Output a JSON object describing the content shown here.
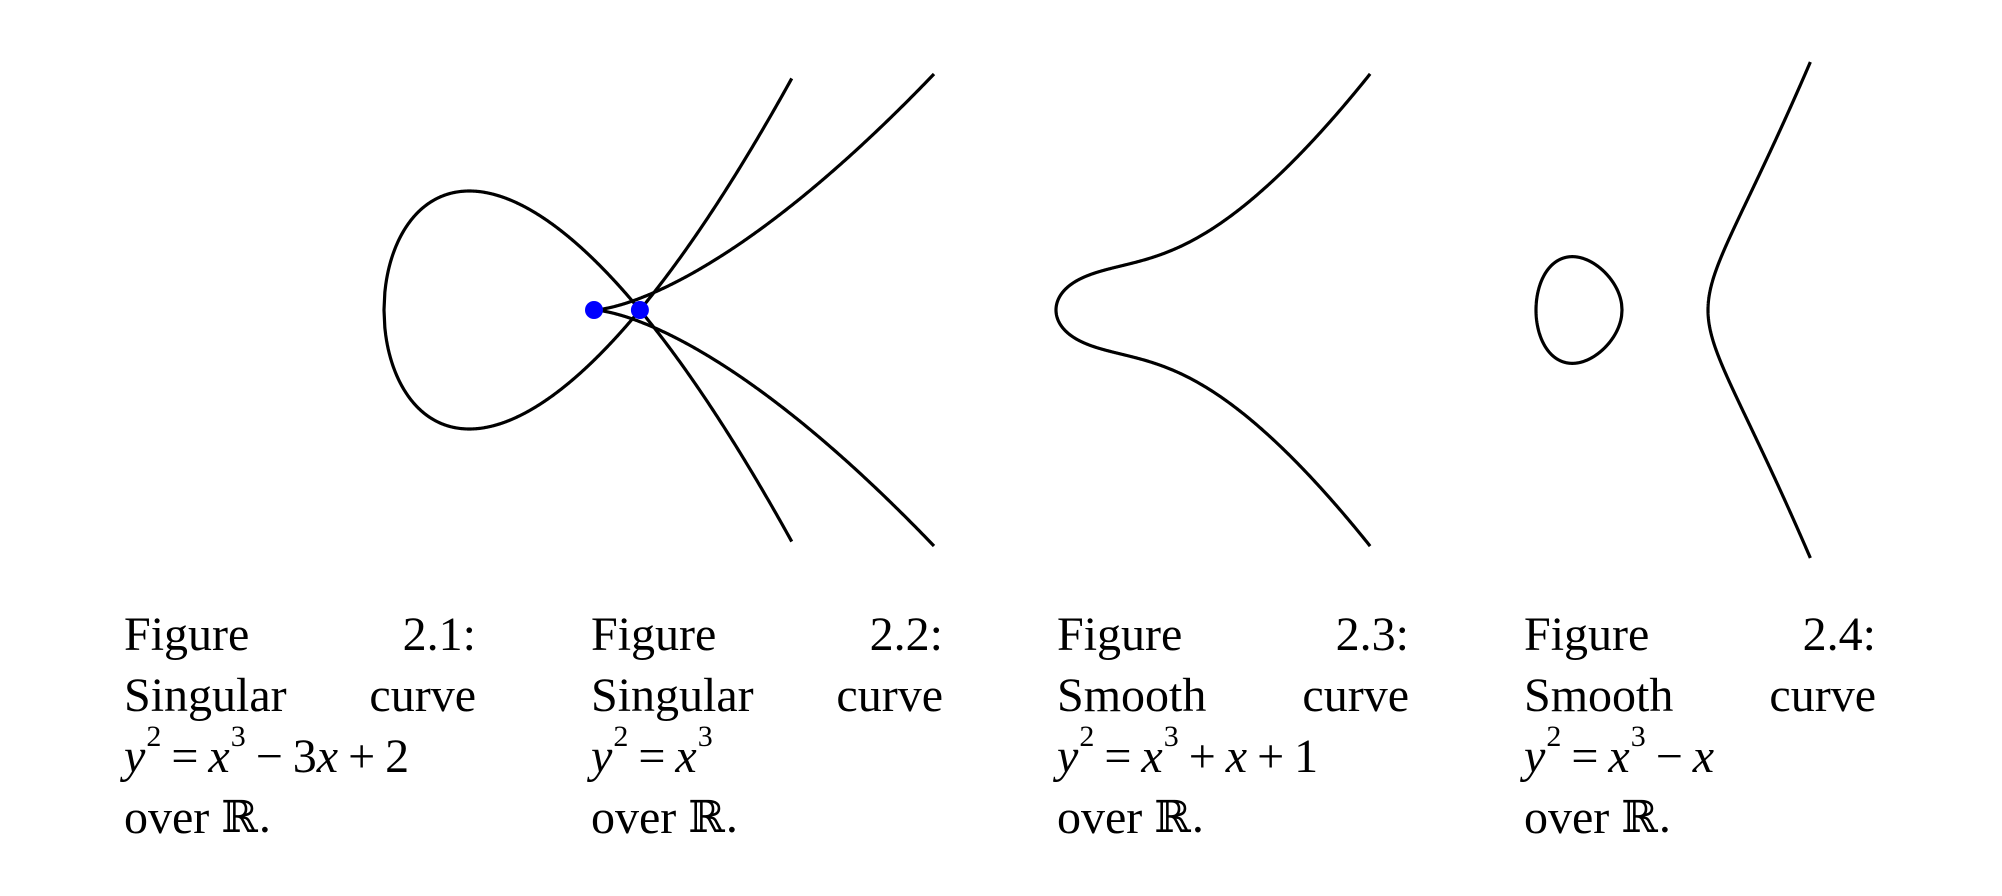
{
  "figures": [
    {
      "label": "Figure",
      "number": "2.1:",
      "description_1": "Singular",
      "description_2": "curve",
      "equation": [
        {
          "t": "y",
          "it": true
        },
        {
          "sup": "2"
        },
        {
          "op": "="
        },
        {
          "t": "x",
          "it": true
        },
        {
          "sup": "3"
        },
        {
          "op": "−"
        },
        {
          "t": "3"
        },
        {
          "t": "x",
          "it": true
        },
        {
          "op": "+"
        },
        {
          "t": "2"
        }
      ],
      "over": "over",
      "field": "ℝ.",
      "curve": {
        "a": -3,
        "b": 2,
        "singular_point": [
          1,
          0
        ]
      }
    },
    {
      "label": "Figure",
      "number": "2.2:",
      "description_1": "Singular",
      "description_2": "curve",
      "equation": [
        {
          "t": "y",
          "it": true
        },
        {
          "sup": "2"
        },
        {
          "op": "="
        },
        {
          "t": "x",
          "it": true
        },
        {
          "sup": "3"
        }
      ],
      "over": "over",
      "field": "ℝ.",
      "curve": {
        "a": 0,
        "b": 0,
        "singular_point": [
          0,
          0
        ]
      }
    },
    {
      "label": "Figure",
      "number": "2.3:",
      "description_1": "Smooth",
      "description_2": "curve",
      "equation": [
        {
          "t": "y",
          "it": true
        },
        {
          "sup": "2"
        },
        {
          "op": "="
        },
        {
          "t": "x",
          "it": true
        },
        {
          "sup": "3"
        },
        {
          "op": "+"
        },
        {
          "t": "x",
          "it": true
        },
        {
          "op": "+"
        },
        {
          "t": "1"
        }
      ],
      "over": "over",
      "field": "ℝ.",
      "curve": {
        "a": 1,
        "b": 1
      }
    },
    {
      "label": "Figure",
      "number": "2.4:",
      "description_1": "Smooth",
      "description_2": "curve",
      "equation": [
        {
          "t": "y",
          "it": true
        },
        {
          "sup": "2"
        },
        {
          "op": "="
        },
        {
          "t": "x",
          "it": true
        },
        {
          "sup": "3"
        },
        {
          "op": "−"
        },
        {
          "t": "x",
          "it": true
        }
      ],
      "over": "over",
      "field": "ℝ.",
      "curve": {
        "a": -1,
        "b": 0
      }
    }
  ],
  "colors": {
    "curve": "#000000",
    "singular_point": "#0000ff"
  }
}
